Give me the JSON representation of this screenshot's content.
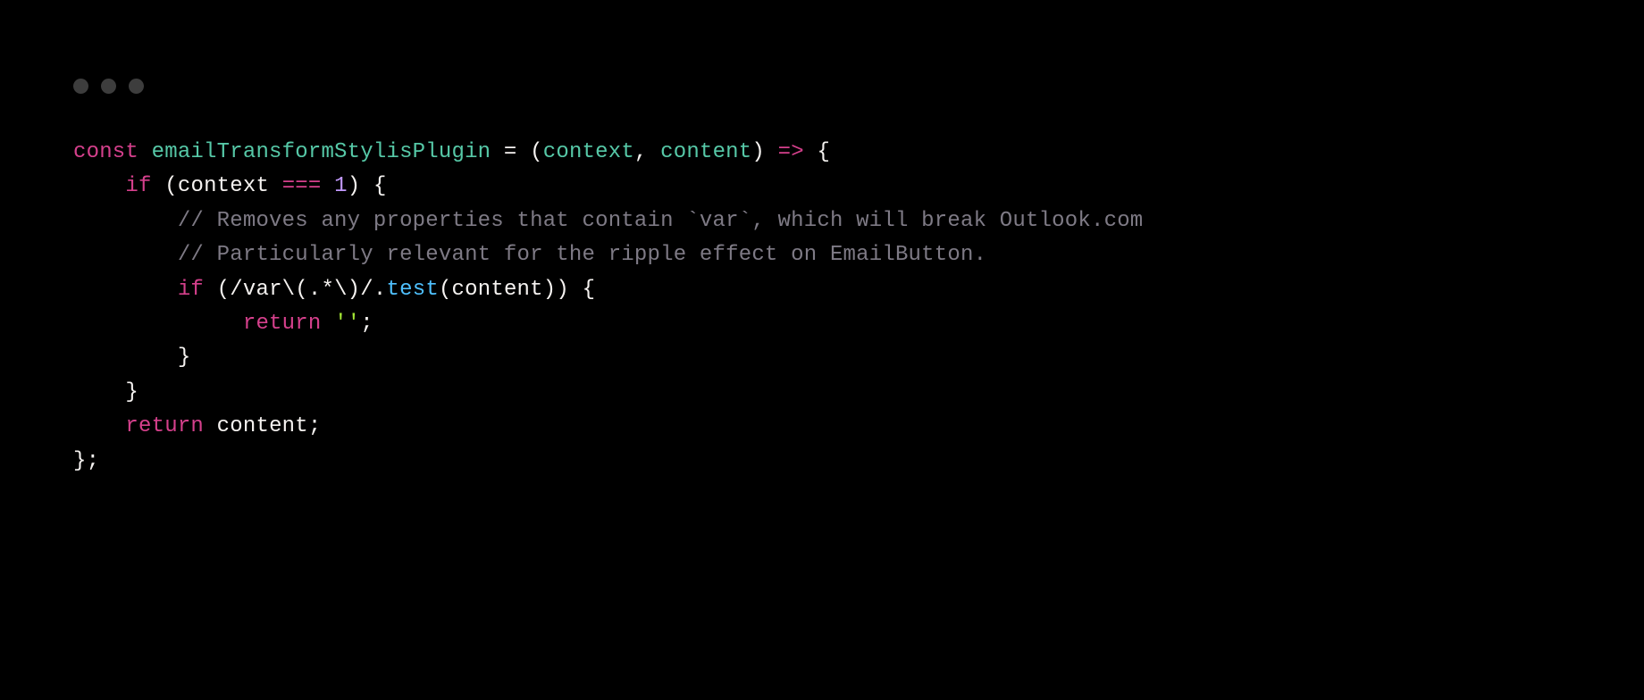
{
  "code": {
    "l1": {
      "const": "const",
      "sp1": " ",
      "name": "emailTransformStylisPlugin",
      "sp2": " ",
      "eq": "=",
      "sp3": " ",
      "op1": "(",
      "arg1": "context",
      "comma": ",",
      "sp4": " ",
      "arg2": "content",
      "op2": ")",
      "sp5": " ",
      "arrow": "=>",
      "sp6": " ",
      "brace": "{"
    },
    "l2": {
      "indent": "    ",
      "if": "if",
      "sp1": " ",
      "op1": "(",
      "var": "context",
      "sp2": " ",
      "eqeq": "===",
      "sp3": " ",
      "num": "1",
      "op2": ")",
      "sp4": " ",
      "brace": "{"
    },
    "l3": {
      "indent": "        ",
      "text": "// Removes any properties that contain `var`, which will break Outlook.com"
    },
    "l4": {
      "indent": "        ",
      "text": "// Particularly relevant for the ripple effect on EmailButton."
    },
    "l5": {
      "indent": "        ",
      "if": "if",
      "sp1": " ",
      "op1": "(",
      "regex": "/var\\(.*\\)/",
      "dot": ".",
      "method": "test",
      "op2": "(",
      "arg": "content",
      "op3": ")",
      "op4": ")",
      "sp2": " ",
      "brace": "{"
    },
    "l6": {
      "indent": "             ",
      "return": "return",
      "sp1": " ",
      "str": "''",
      "semi": ";"
    },
    "l7": {
      "indent": "        ",
      "brace": "}"
    },
    "l8": {
      "indent": "    ",
      "brace": "}"
    },
    "l9": "",
    "l10": {
      "indent": "    ",
      "return": "return",
      "sp1": " ",
      "var": "content",
      "semi": ";"
    },
    "l11": {
      "brace": "}",
      "semi": ";"
    }
  }
}
